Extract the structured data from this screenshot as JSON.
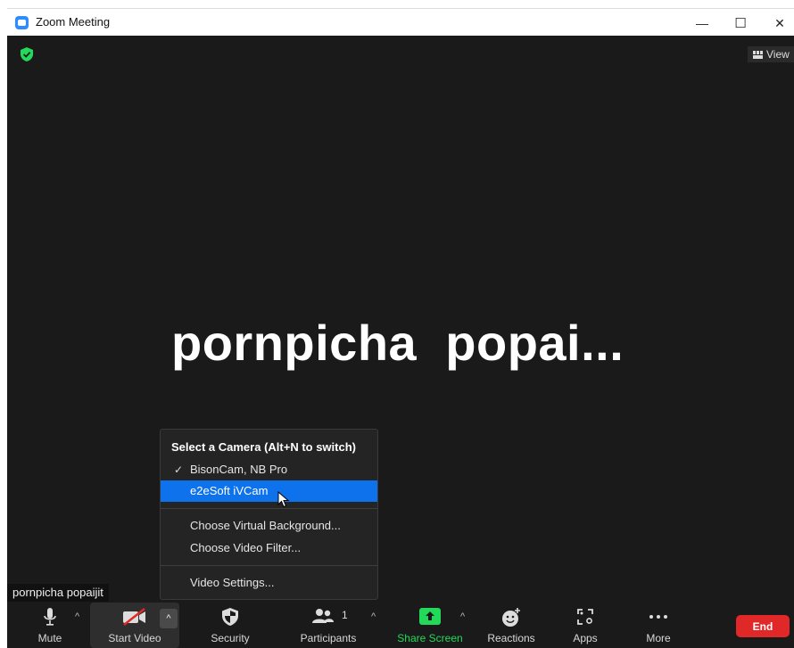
{
  "window": {
    "title": "Zoom Meeting",
    "minimize_glyph": "—",
    "maximize_glyph": "☐",
    "close_glyph": "✕"
  },
  "meeting": {
    "view_label": "View",
    "participant_display_name": "pornpicha  popai...",
    "name_tag": "pornpicha popaijit",
    "encryption_icon": "shield-check-icon",
    "accent_green": "#23d959"
  },
  "camera_menu": {
    "header": "Select a Camera (Alt+N to switch)",
    "cameras": [
      {
        "label": "BisonCam, NB Pro",
        "checked": true
      },
      {
        "label": "e2eSoft iVCam",
        "checked": false,
        "highlighted": true
      }
    ],
    "check_glyph": "✓",
    "options": [
      {
        "label": "Choose Virtual Background..."
      },
      {
        "label": "Choose Video Filter..."
      }
    ],
    "settings_label": "Video Settings...",
    "highlight_color": "#0e72ed"
  },
  "toolbar": {
    "mute_label": "Mute",
    "start_video_label": "Start Video",
    "security_label": "Security",
    "participants_label": "Participants",
    "participants_count": "1",
    "share_screen_label": "Share Screen",
    "reactions_label": "Reactions",
    "apps_label": "Apps",
    "more_label": "More",
    "end_label": "End",
    "caret_glyph": "^",
    "end_color": "#e02828",
    "share_color": "#23d959"
  }
}
